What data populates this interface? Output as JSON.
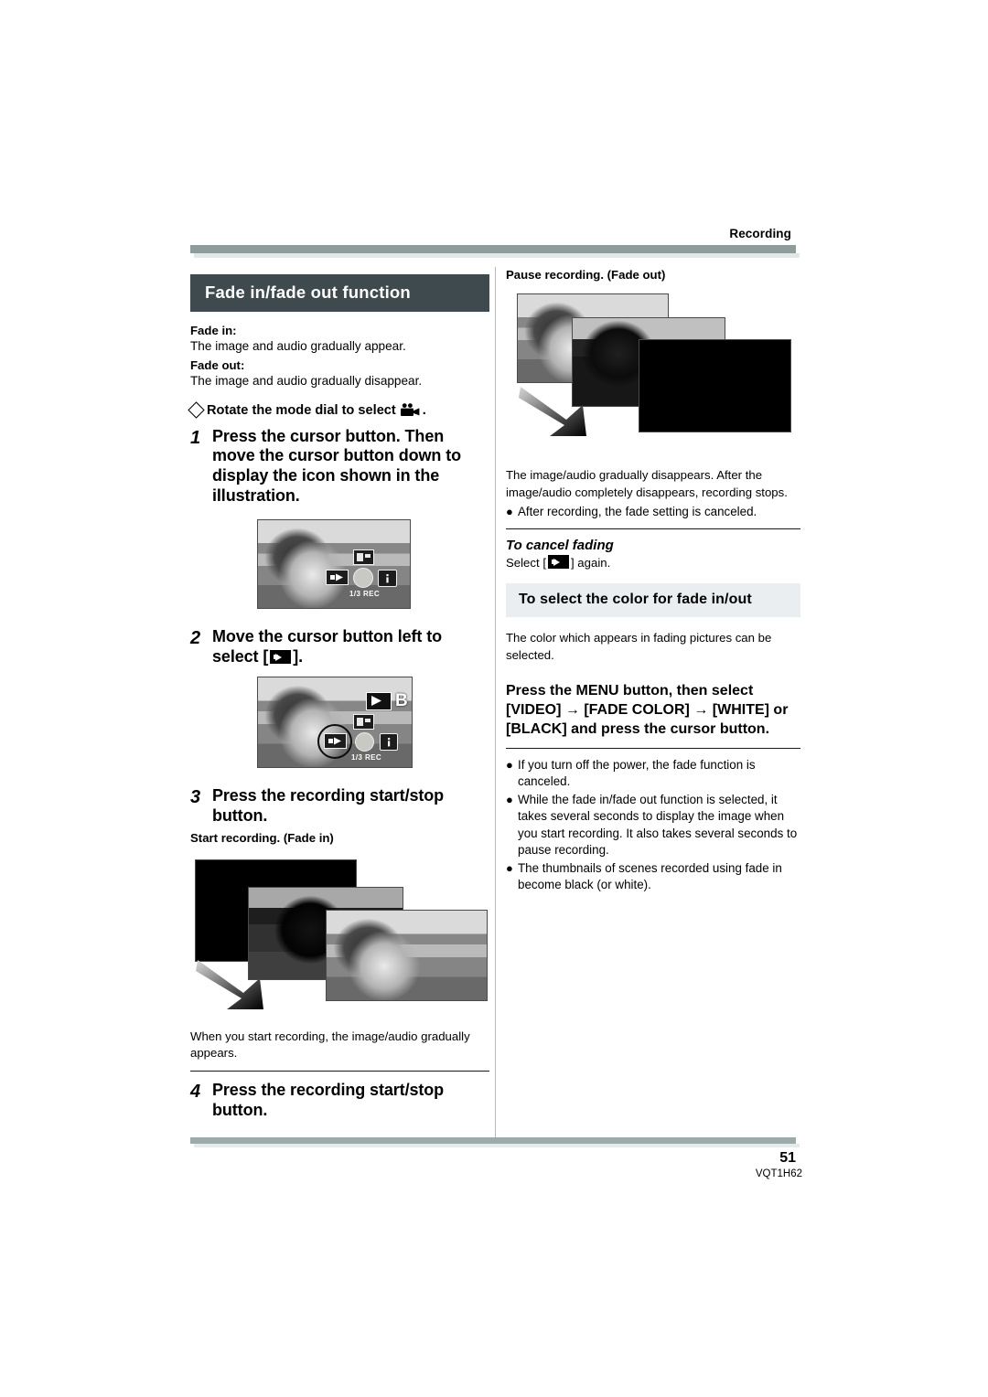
{
  "header": {
    "section_label": "Recording"
  },
  "left_column": {
    "section_banner": "Fade in/fade out function",
    "fade_in_label": "Fade in:",
    "fade_in_desc": "The image and audio gradually appear.",
    "fade_out_label": "Fade out:",
    "fade_out_desc": "The image and audio gradually disappear.",
    "mode_dial_line": "Rotate the mode dial to select",
    "mode_dial_icon": "movie-camera-icon",
    "mode_dial_trailing": ".",
    "steps": [
      {
        "number": "1",
        "text": "Press the cursor button. Then move the cursor button down to display the icon shown in the illustration."
      },
      {
        "number": "2",
        "text_before": "Move the cursor button left to select [",
        "icon": "fade-icon",
        "text_after": "]."
      },
      {
        "number": "3",
        "text": "Press the recording start/stop button."
      },
      {
        "number": "4",
        "text": "Press the recording start/stop button."
      }
    ],
    "start_recording_label": "Start recording. (Fade in)",
    "fade_in_caption": "When you start recording, the image/audio gradually appears.",
    "screen_overlay": {
      "rec_label": "1/3 REC",
      "callout_letter": "B"
    }
  },
  "right_column": {
    "pause_recording_label": "Pause recording. (Fade out)",
    "fade_out_caption": "The image/audio gradually disappears. After the image/audio completely disappears, recording stops.",
    "fade_out_bullet": "After recording, the fade setting is canceled.",
    "cancel_heading": "To cancel fading",
    "cancel_text_before": "Select [",
    "cancel_icon": "fade-icon",
    "cancel_text_after": "] again.",
    "color_banner": "To select the color for fade in/out",
    "color_desc": "The color which appears in fading pictures can be selected.",
    "menu_instruction": "Press the MENU button, then select [VIDEO] → [FADE COLOR] → [WHITE] or [BLACK] and press the cursor button.",
    "notes": [
      "If you turn off the power, the fade function is canceled.",
      "While the fade in/fade out function is selected, it takes several seconds to display the image when you start recording. It also takes several seconds to pause recording.",
      "The thumbnails of scenes recorded using fade in become black (or white)."
    ],
    "bullet_glyph": "●"
  },
  "footer": {
    "page_number": "51",
    "document_code": "VQT1H62"
  },
  "colors": {
    "banner_dark": "#3e4a4d",
    "banner_light": "#eaeef0",
    "rule_green": "#8e9d9b",
    "text": "#000000"
  }
}
